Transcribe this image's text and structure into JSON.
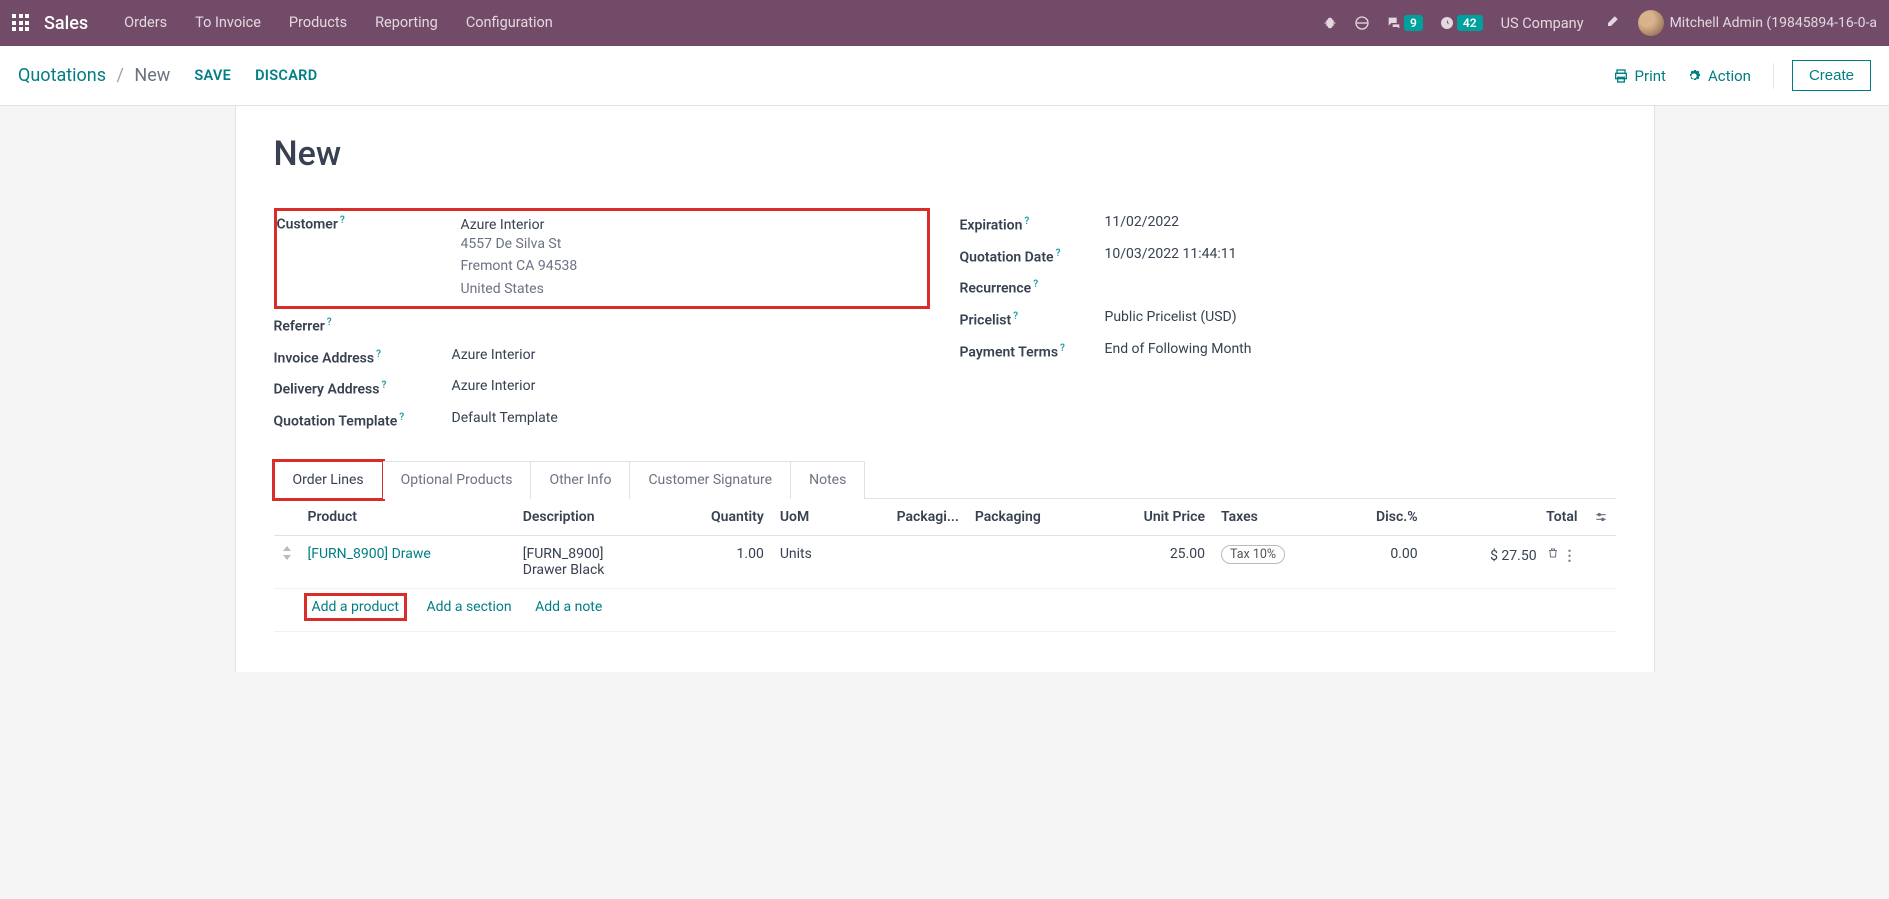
{
  "nav": {
    "brand": "Sales",
    "items": [
      "Orders",
      "To Invoice",
      "Products",
      "Reporting",
      "Configuration"
    ],
    "msg_badge": "9",
    "activity_badge": "42",
    "company": "US Company",
    "user": "Mitchell Admin (19845894-16-0-a"
  },
  "control": {
    "bc_root": "Quotations",
    "bc_current": "New",
    "save": "SAVE",
    "discard": "DISCARD",
    "print": "Print",
    "action": "Action",
    "create": "Create"
  },
  "form": {
    "title": "New",
    "left": {
      "customer_label": "Customer",
      "customer_name": "Azure Interior",
      "customer_addr1": "4557 De Silva St",
      "customer_addr2": "Fremont CA 94538",
      "customer_addr3": "United States",
      "referrer_label": "Referrer",
      "invoice_addr_label": "Invoice Address",
      "invoice_addr": "Azure Interior",
      "delivery_addr_label": "Delivery Address",
      "delivery_addr": "Azure Interior",
      "template_label": "Quotation Template",
      "template": "Default Template"
    },
    "right": {
      "expiration_label": "Expiration",
      "expiration": "11/02/2022",
      "quote_date_label": "Quotation Date",
      "quote_date": "10/03/2022 11:44:11",
      "recurrence_label": "Recurrence",
      "pricelist_label": "Pricelist",
      "pricelist": "Public Pricelist (USD)",
      "payterms_label": "Payment Terms",
      "payterms": "End of Following Month"
    }
  },
  "tabs": {
    "t0": "Order Lines",
    "t1": "Optional Products",
    "t2": "Other Info",
    "t3": "Customer Signature",
    "t4": "Notes"
  },
  "table": {
    "h_product": "Product",
    "h_desc": "Description",
    "h_qty": "Quantity",
    "h_uom": "UoM",
    "h_pack1": "Packagi...",
    "h_pack2": "Packaging",
    "h_price": "Unit Price",
    "h_taxes": "Taxes",
    "h_disc": "Disc.%",
    "h_total": "Total",
    "row": {
      "product": "[FURN_8900] Drawe",
      "desc1": "[FURN_8900]",
      "desc2": "Drawer Black",
      "qty": "1.00",
      "uom": "Units",
      "price": "25.00",
      "tax": "Tax 10%",
      "disc": "0.00",
      "total": "$ 27.50"
    },
    "add_product": "Add a product",
    "add_section": "Add a section",
    "add_note": "Add a note"
  }
}
